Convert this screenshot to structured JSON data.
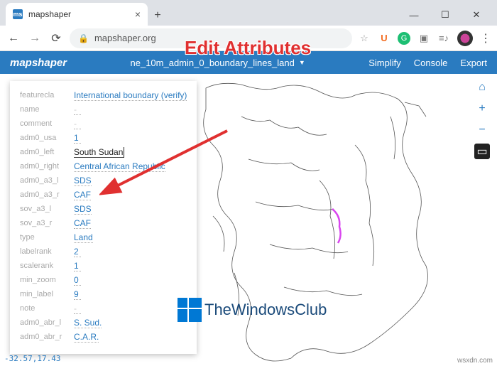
{
  "browser": {
    "tab_title": "mapshaper",
    "url_display": "mapshaper.org"
  },
  "app": {
    "logo": "mapshaper",
    "current_file": "ne_10m_admin_0_boundary_lines_land",
    "actions": {
      "simplify": "Simplify",
      "console": "Console",
      "export": "Export"
    }
  },
  "attributes": [
    {
      "key": "featurecla",
      "val": "International boundary (verify)"
    },
    {
      "key": "name",
      "val": "-"
    },
    {
      "key": "comment",
      "val": "-"
    },
    {
      "key": "adm0_usa",
      "val": "1"
    },
    {
      "key": "adm0_left",
      "val": "South Sudan",
      "editing": true
    },
    {
      "key": "adm0_right",
      "val": "Central African Republic"
    },
    {
      "key": "adm0_a3_l",
      "val": "SDS"
    },
    {
      "key": "adm0_a3_r",
      "val": "CAF"
    },
    {
      "key": "sov_a3_l",
      "val": "SDS"
    },
    {
      "key": "sov_a3_r",
      "val": "CAF"
    },
    {
      "key": "type",
      "val": "Land"
    },
    {
      "key": "labelrank",
      "val": "2"
    },
    {
      "key": "scalerank",
      "val": "1"
    },
    {
      "key": "min_zoom",
      "val": "0"
    },
    {
      "key": "min_label",
      "val": "9"
    },
    {
      "key": "note",
      "val": "-"
    },
    {
      "key": "adm0_abr_l",
      "val": "S. Sud."
    },
    {
      "key": "adm0_abr_r",
      "val": "C.A.R."
    }
  ],
  "coords": "-32.57,17.43",
  "annotation": "Edit Attributes",
  "watermark": "TheWindowsClub",
  "source": "wsxdn.com"
}
